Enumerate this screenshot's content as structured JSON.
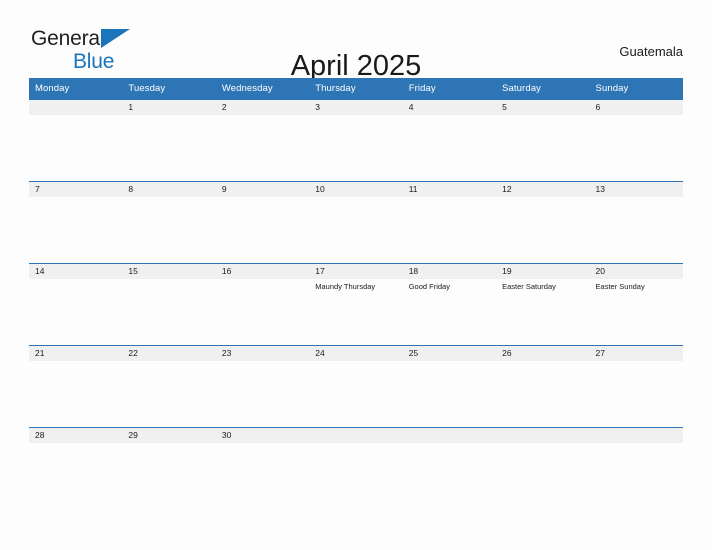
{
  "brand": {
    "name_line1": "General",
    "name_line2": "Blue",
    "triangle_icon": "triangle-icon",
    "color_dark": "#231f20",
    "color_blue": "#1b75bb"
  },
  "header": {
    "title": "April 2025",
    "country": "Guatemala"
  },
  "theme": {
    "header_blue": "#2e75b6",
    "row_strip_gray": "#f0f0f0",
    "page_background": "#fdfdfd",
    "text_dark": "#1a1a1a"
  },
  "calendar": {
    "weekday_headers": [
      "Monday",
      "Tuesday",
      "Wednesday",
      "Thursday",
      "Friday",
      "Saturday",
      "Sunday"
    ],
    "weeks": [
      [
        {
          "day": "",
          "events": []
        },
        {
          "day": "1",
          "events": []
        },
        {
          "day": "2",
          "events": []
        },
        {
          "day": "3",
          "events": []
        },
        {
          "day": "4",
          "events": []
        },
        {
          "day": "5",
          "events": []
        },
        {
          "day": "6",
          "events": []
        }
      ],
      [
        {
          "day": "7",
          "events": []
        },
        {
          "day": "8",
          "events": []
        },
        {
          "day": "9",
          "events": []
        },
        {
          "day": "10",
          "events": []
        },
        {
          "day": "11",
          "events": []
        },
        {
          "day": "12",
          "events": []
        },
        {
          "day": "13",
          "events": []
        }
      ],
      [
        {
          "day": "14",
          "events": []
        },
        {
          "day": "15",
          "events": []
        },
        {
          "day": "16",
          "events": []
        },
        {
          "day": "17",
          "events": [
            "Maundy Thursday"
          ]
        },
        {
          "day": "18",
          "events": [
            "Good Friday"
          ]
        },
        {
          "day": "19",
          "events": [
            "Easter Saturday"
          ]
        },
        {
          "day": "20",
          "events": [
            "Easter Sunday"
          ]
        }
      ],
      [
        {
          "day": "21",
          "events": []
        },
        {
          "day": "22",
          "events": []
        },
        {
          "day": "23",
          "events": []
        },
        {
          "day": "24",
          "events": []
        },
        {
          "day": "25",
          "events": []
        },
        {
          "day": "26",
          "events": []
        },
        {
          "day": "27",
          "events": []
        }
      ],
      [
        {
          "day": "28",
          "events": []
        },
        {
          "day": "29",
          "events": []
        },
        {
          "day": "30",
          "events": []
        },
        {
          "day": "",
          "events": []
        },
        {
          "day": "",
          "events": []
        },
        {
          "day": "",
          "events": []
        },
        {
          "day": "",
          "events": []
        }
      ]
    ]
  }
}
